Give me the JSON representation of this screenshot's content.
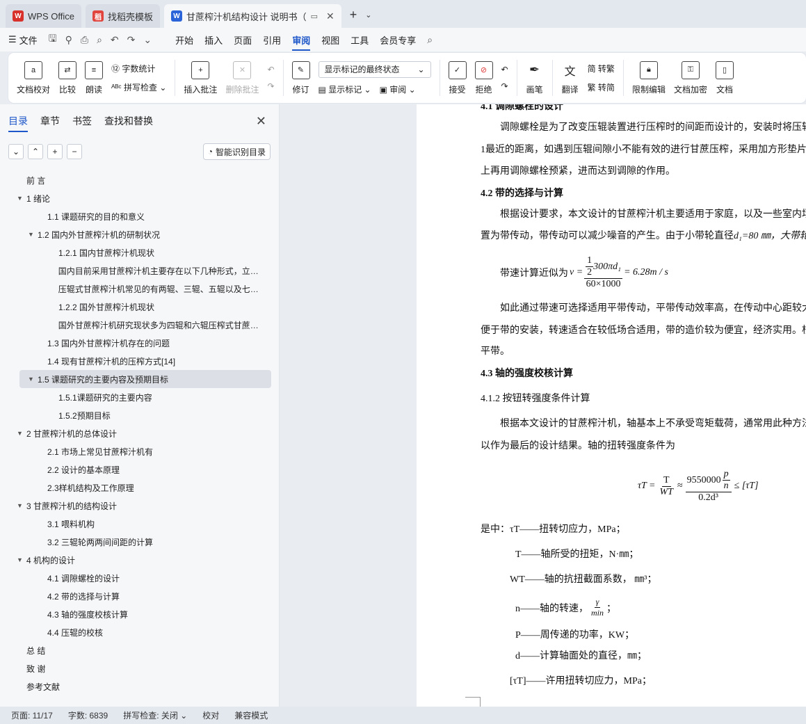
{
  "tabs": [
    {
      "label": "WPS Office",
      "icon": "wps-logo-icon"
    },
    {
      "label": "找稻壳模板",
      "icon": "docer-logo-icon"
    },
    {
      "label": "甘蔗榨汁机结构设计 说明书（",
      "icon": "writer-logo-icon"
    }
  ],
  "menu": {
    "file": "文件",
    "items": [
      "开始",
      "插入",
      "页面",
      "引用",
      "审阅",
      "视图",
      "工具",
      "会员专享"
    ],
    "active": "审阅"
  },
  "ribbon": {
    "doc_check": "文档校对",
    "compare": "比较",
    "read_aloud": "朗读",
    "word_count": "字数统计",
    "spell_check": "拼写检查",
    "insert_comment": "插入批注",
    "delete_comment": "删除批注",
    "track": "修订",
    "display_state": "显示标记的最终状态",
    "show_markup": "显示标记",
    "review": "审阅",
    "accept": "接受",
    "reject": "拒绝",
    "pen": "画笔",
    "translate": "翻译",
    "to_trad": "转繁",
    "to_simp": "转简",
    "restrict": "限制编辑",
    "encrypt": "文档加密",
    "doc_more": "文档"
  },
  "nav": {
    "tabs": [
      "目录",
      "章节",
      "书签",
      "查找和替换"
    ],
    "smart_btn": "智能识别目录",
    "toc": [
      {
        "text": "前 言",
        "level": "l1",
        "arrow": ""
      },
      {
        "text": "1 绪论",
        "level": "l1",
        "arrow": "▼"
      },
      {
        "text": "1.1 课题研究的目的和意义",
        "level": "l2",
        "arrow": ""
      },
      {
        "text": "1.2 国内外甘蔗榨汁机的研制状况",
        "level": "l2a",
        "arrow": "▼"
      },
      {
        "text": "1.2.1 国内甘蔗榨汁机现状",
        "level": "l3",
        "arrow": ""
      },
      {
        "text": "国内目前采用甘蔗榨汁机主要存在以下几种形式，立式 ...",
        "level": "l3t",
        "arrow": ""
      },
      {
        "text": "压辊式甘蔗榨汁机常见的有两辊、三辊、五辊以及七辊 ...",
        "level": "l3t",
        "arrow": ""
      },
      {
        "text": "1.2.2  国外甘蔗榨汁机现状",
        "level": "l3",
        "arrow": ""
      },
      {
        "text": "国外甘蔗榨汁机研究现状多为四辊和六辊压榨式甘蔗榨 ...",
        "level": "l3t",
        "arrow": ""
      },
      {
        "text": "1.3 国内外甘蔗榨汁机存在的问题",
        "level": "l2",
        "arrow": ""
      },
      {
        "text": "1.4 现有甘蔗榨汁机的压榨方式[14]",
        "level": "l2",
        "arrow": ""
      },
      {
        "text": "1.5 课题研究的主要内容及预期目标",
        "level": "sel",
        "arrow": "▼"
      },
      {
        "text": "1.5.1课题研究的主要内容",
        "level": "l3",
        "arrow": ""
      },
      {
        "text": "1.5.2预期目标",
        "level": "l3",
        "arrow": ""
      },
      {
        "text": "2 甘蔗榨汁机的总体设计",
        "level": "l1",
        "arrow": "▼"
      },
      {
        "text": "2.1 市场上常见甘蔗榨汁机有",
        "level": "l2",
        "arrow": ""
      },
      {
        "text": "2.2 设计的基本原理",
        "level": "l2",
        "arrow": ""
      },
      {
        "text": "2.3样机结构及工作原理",
        "level": "l2",
        "arrow": ""
      },
      {
        "text": "3 甘蔗榨汁机的结构设计",
        "level": "l1",
        "arrow": "▼"
      },
      {
        "text": "3.1 喂料机构",
        "level": "l2",
        "arrow": ""
      },
      {
        "text": "3.2 三辊轮两两间间距的计算",
        "level": "l2",
        "arrow": ""
      },
      {
        "text": "4 机构的设计",
        "level": "l1",
        "arrow": "▼"
      },
      {
        "text": "4.1 调隙螺栓的设计",
        "level": "l2",
        "arrow": ""
      },
      {
        "text": "4.2 带的选择与计算",
        "level": "l2",
        "arrow": ""
      },
      {
        "text": "4.3 轴的强度校核计算",
        "level": "l2",
        "arrow": ""
      },
      {
        "text": "4.4 压辊的校核",
        "level": "l2",
        "arrow": ""
      },
      {
        "text": "总 结",
        "level": "l1",
        "arrow": ""
      },
      {
        "text": "致 谢",
        "level": "l1",
        "arrow": ""
      },
      {
        "text": "参考文献",
        "level": "l1",
        "arrow": ""
      }
    ]
  },
  "doc": {
    "h41": "4.1 调隙螺栓的设计",
    "p1a": "调隙螺栓是为了改变压辊装置进行压榨时的间距而设计的，安装时将压辊",
    "p1b": "1最近的距离，如遇到压辊间隙小不能有效的进行甘蔗压榨，采用加方形垫片",
    "p1c": "上再用调隙螺栓预紧，进而达到调隙的作用。",
    "h42": "4.2 带的选择与计算",
    "p2a": "根据设计要求，本文设计的甘蔗榨汁机主要适用于家庭，以及一些室内场",
    "p2b": "置为带传动，带传动可以减少噪音的产生。由于小带轮直径",
    "p2b_math": "d₁=80 ㎜，大带轮",
    "speed_label": "带速计算近似为",
    "speed_v": "v =",
    "speed_num_top": "1",
    "speed_num_bot": "2",
    "speed_num_rest": "300πd₁",
    "speed_den": "60×1000",
    "speed_res": "= 6.28m / s",
    "p3a": "如此通过带速可选择适用平带传动，平带传动效率高，在传动中心距较大",
    "p3b": "便于带的安装，转速适合在较低场合适用，带的造价较为便宜，经济实用。根",
    "p3c": "平带。",
    "h43": "4.3 轴的强度校核计算",
    "h412": "4.1.2 按钮转强度条件计算",
    "p4a": "根据本文设计的甘蔗榨汁机，轴基本上不承受弯矩载荷，通常用此种方法",
    "p4b": "以作为最后的设计结果。轴的扭转强度条件为",
    "eq_lhs": "τT =",
    "eq_T": "T",
    "eq_W": "WT",
    "eq_approx": "≈",
    "eq_num": "9550000",
    "eq_p": "p",
    "eq_n": "n",
    "eq_den": "0.2d³",
    "eq_rhs": "≤ [τT]",
    "where": "是中：τT——扭转切应力，MPa；",
    "def_T": "T——轴所受的扭矩，N·㎜；",
    "def_W": "WT——轴的抗扭截面系数，  ㎜³；",
    "def_n": "n——轴的转速，",
    "def_n_unit_top": "γ",
    "def_n_unit_bot": "min",
    "def_n_end": "；",
    "def_P": "P——周传递的功率，KW；",
    "def_d": "d——计算轴面处的直径，㎜；",
    "def_tau": "[τT]——许用扭转切应力，MPa；"
  },
  "status": {
    "page": "页面: 11/17",
    "words": "字数: 6839",
    "spell": "拼写检查: 关闭",
    "proof": "校对",
    "compat": "兼容模式"
  }
}
